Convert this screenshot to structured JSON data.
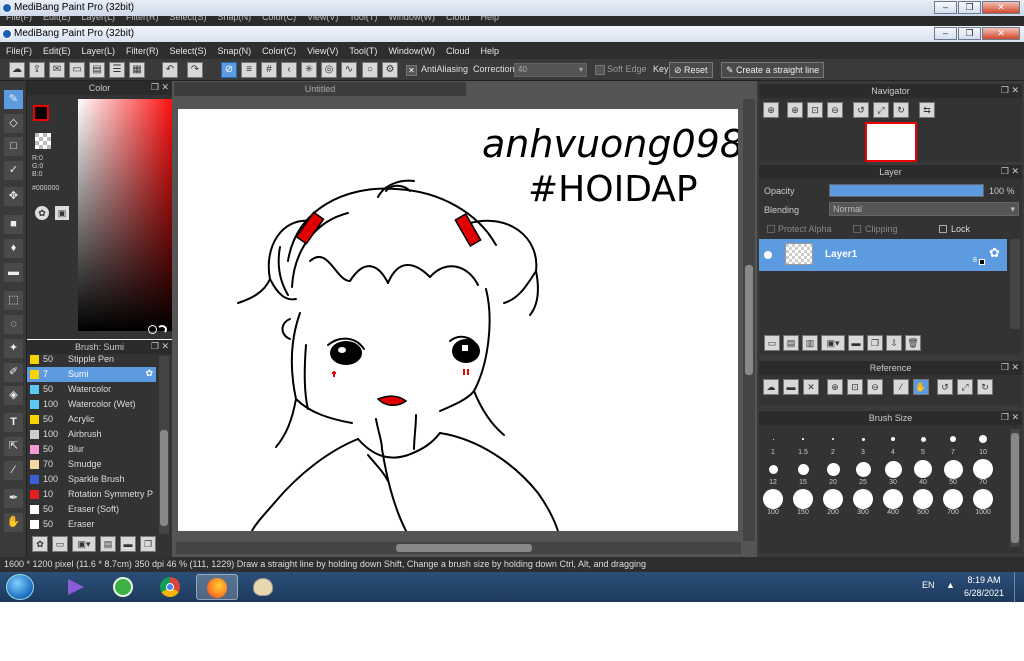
{
  "back_window": {
    "title": "MediBang Paint Pro (32bit)",
    "menu": [
      "File(F)",
      "Edit(E)",
      "Layer(L)",
      "Filter(R)",
      "Select(S)",
      "Snap(N)",
      "Color(C)",
      "View(V)",
      "Tool(T)",
      "Window(W)",
      "Cloud",
      "Help"
    ]
  },
  "window": {
    "title": "MediBang Paint Pro (32bit)",
    "minimize": "–",
    "maximize": "❐",
    "close": "✕"
  },
  "menu": [
    "File(F)",
    "Edit(E)",
    "Layer(L)",
    "Filter(R)",
    "Select(S)",
    "Snap(N)",
    "Color(C)",
    "View(V)",
    "Tool(T)",
    "Window(W)",
    "Cloud",
    "Help"
  ],
  "toolbar": {
    "antialiasing_label": "AntiAliasing",
    "correction_label": "Correction",
    "correction_value": "40",
    "soft_edge_label": "Soft Edge",
    "key_label": "Key",
    "reset_label": "Reset",
    "straight_line_label": "Create a straight line"
  },
  "color_panel": {
    "title": "Color",
    "r": "R:0",
    "g": "G:0",
    "b": "B:0",
    "hex": "#000000",
    "primary_color": "#000000",
    "accent_border": "#e00000"
  },
  "brush_panel": {
    "title": "Brush: Sumi",
    "items": [
      {
        "size": "50",
        "name": "Stipple Pen",
        "color": "#f5d400"
      },
      {
        "size": "7",
        "name": "Sumi",
        "color": "#f5d400",
        "selected": true
      },
      {
        "size": "50",
        "name": "Watercolor",
        "color": "#5bc8f5"
      },
      {
        "size": "100",
        "name": "Watercolor (Wet)",
        "color": "#5bc8f5"
      },
      {
        "size": "50",
        "name": "Acrylic",
        "color": "#f5d400"
      },
      {
        "size": "100",
        "name": "Airbrush",
        "color": "#cccccc"
      },
      {
        "size": "50",
        "name": "Blur",
        "color": "#f59ad6"
      },
      {
        "size": "70",
        "name": "Smudge",
        "color": "#f5d9a0"
      },
      {
        "size": "100",
        "name": "Sparkle Brush",
        "color": "#3a5fd6"
      },
      {
        "size": "10",
        "name": "Rotation Symmetry P",
        "color": "#e02020"
      },
      {
        "size": "50",
        "name": "Eraser (Soft)",
        "color": "#ffffff"
      },
      {
        "size": "50",
        "name": "Eraser",
        "color": "#ffffff"
      }
    ]
  },
  "canvas": {
    "tab": "Untitled",
    "handwriting_1": "anhvuong098",
    "handwriting_2": "#HOIDAP"
  },
  "navigator": {
    "title": "Navigator"
  },
  "layer_panel": {
    "title": "Layer",
    "opacity_label": "Opacity",
    "opacity_value": "100 %",
    "opacity_fraction": 1.0,
    "blending_label": "Blending",
    "blending_value": "Normal",
    "protect_alpha": "Protect Alpha",
    "clipping": "Clipping",
    "lock": "Lock",
    "layer_name": "Layer1",
    "layer_badge": "8"
  },
  "reference": {
    "title": "Reference"
  },
  "brush_size": {
    "title": "Brush Size",
    "sizes": [
      "1",
      "1.5",
      "2",
      "3",
      "4",
      "5",
      "7",
      "10",
      "12",
      "15",
      "20",
      "25",
      "30",
      "40",
      "50",
      "70",
      "100",
      "150",
      "200",
      "300",
      "400",
      "500",
      "700",
      "1000"
    ]
  },
  "status": {
    "dimensions": "1600 * 1200 pixel",
    "physical": "(11.6 * 8.7cm)",
    "dpi": "350 dpi",
    "zoom": "46 %",
    "coords": "(111, 1229)",
    "hint": "Draw a straight line by holding down Shift, Change a brush size by holding down Ctrl, Alt, and dragging"
  },
  "taskbar": {
    "lang": "EN",
    "time": "8:19 AM",
    "date": "6/28/2021"
  }
}
